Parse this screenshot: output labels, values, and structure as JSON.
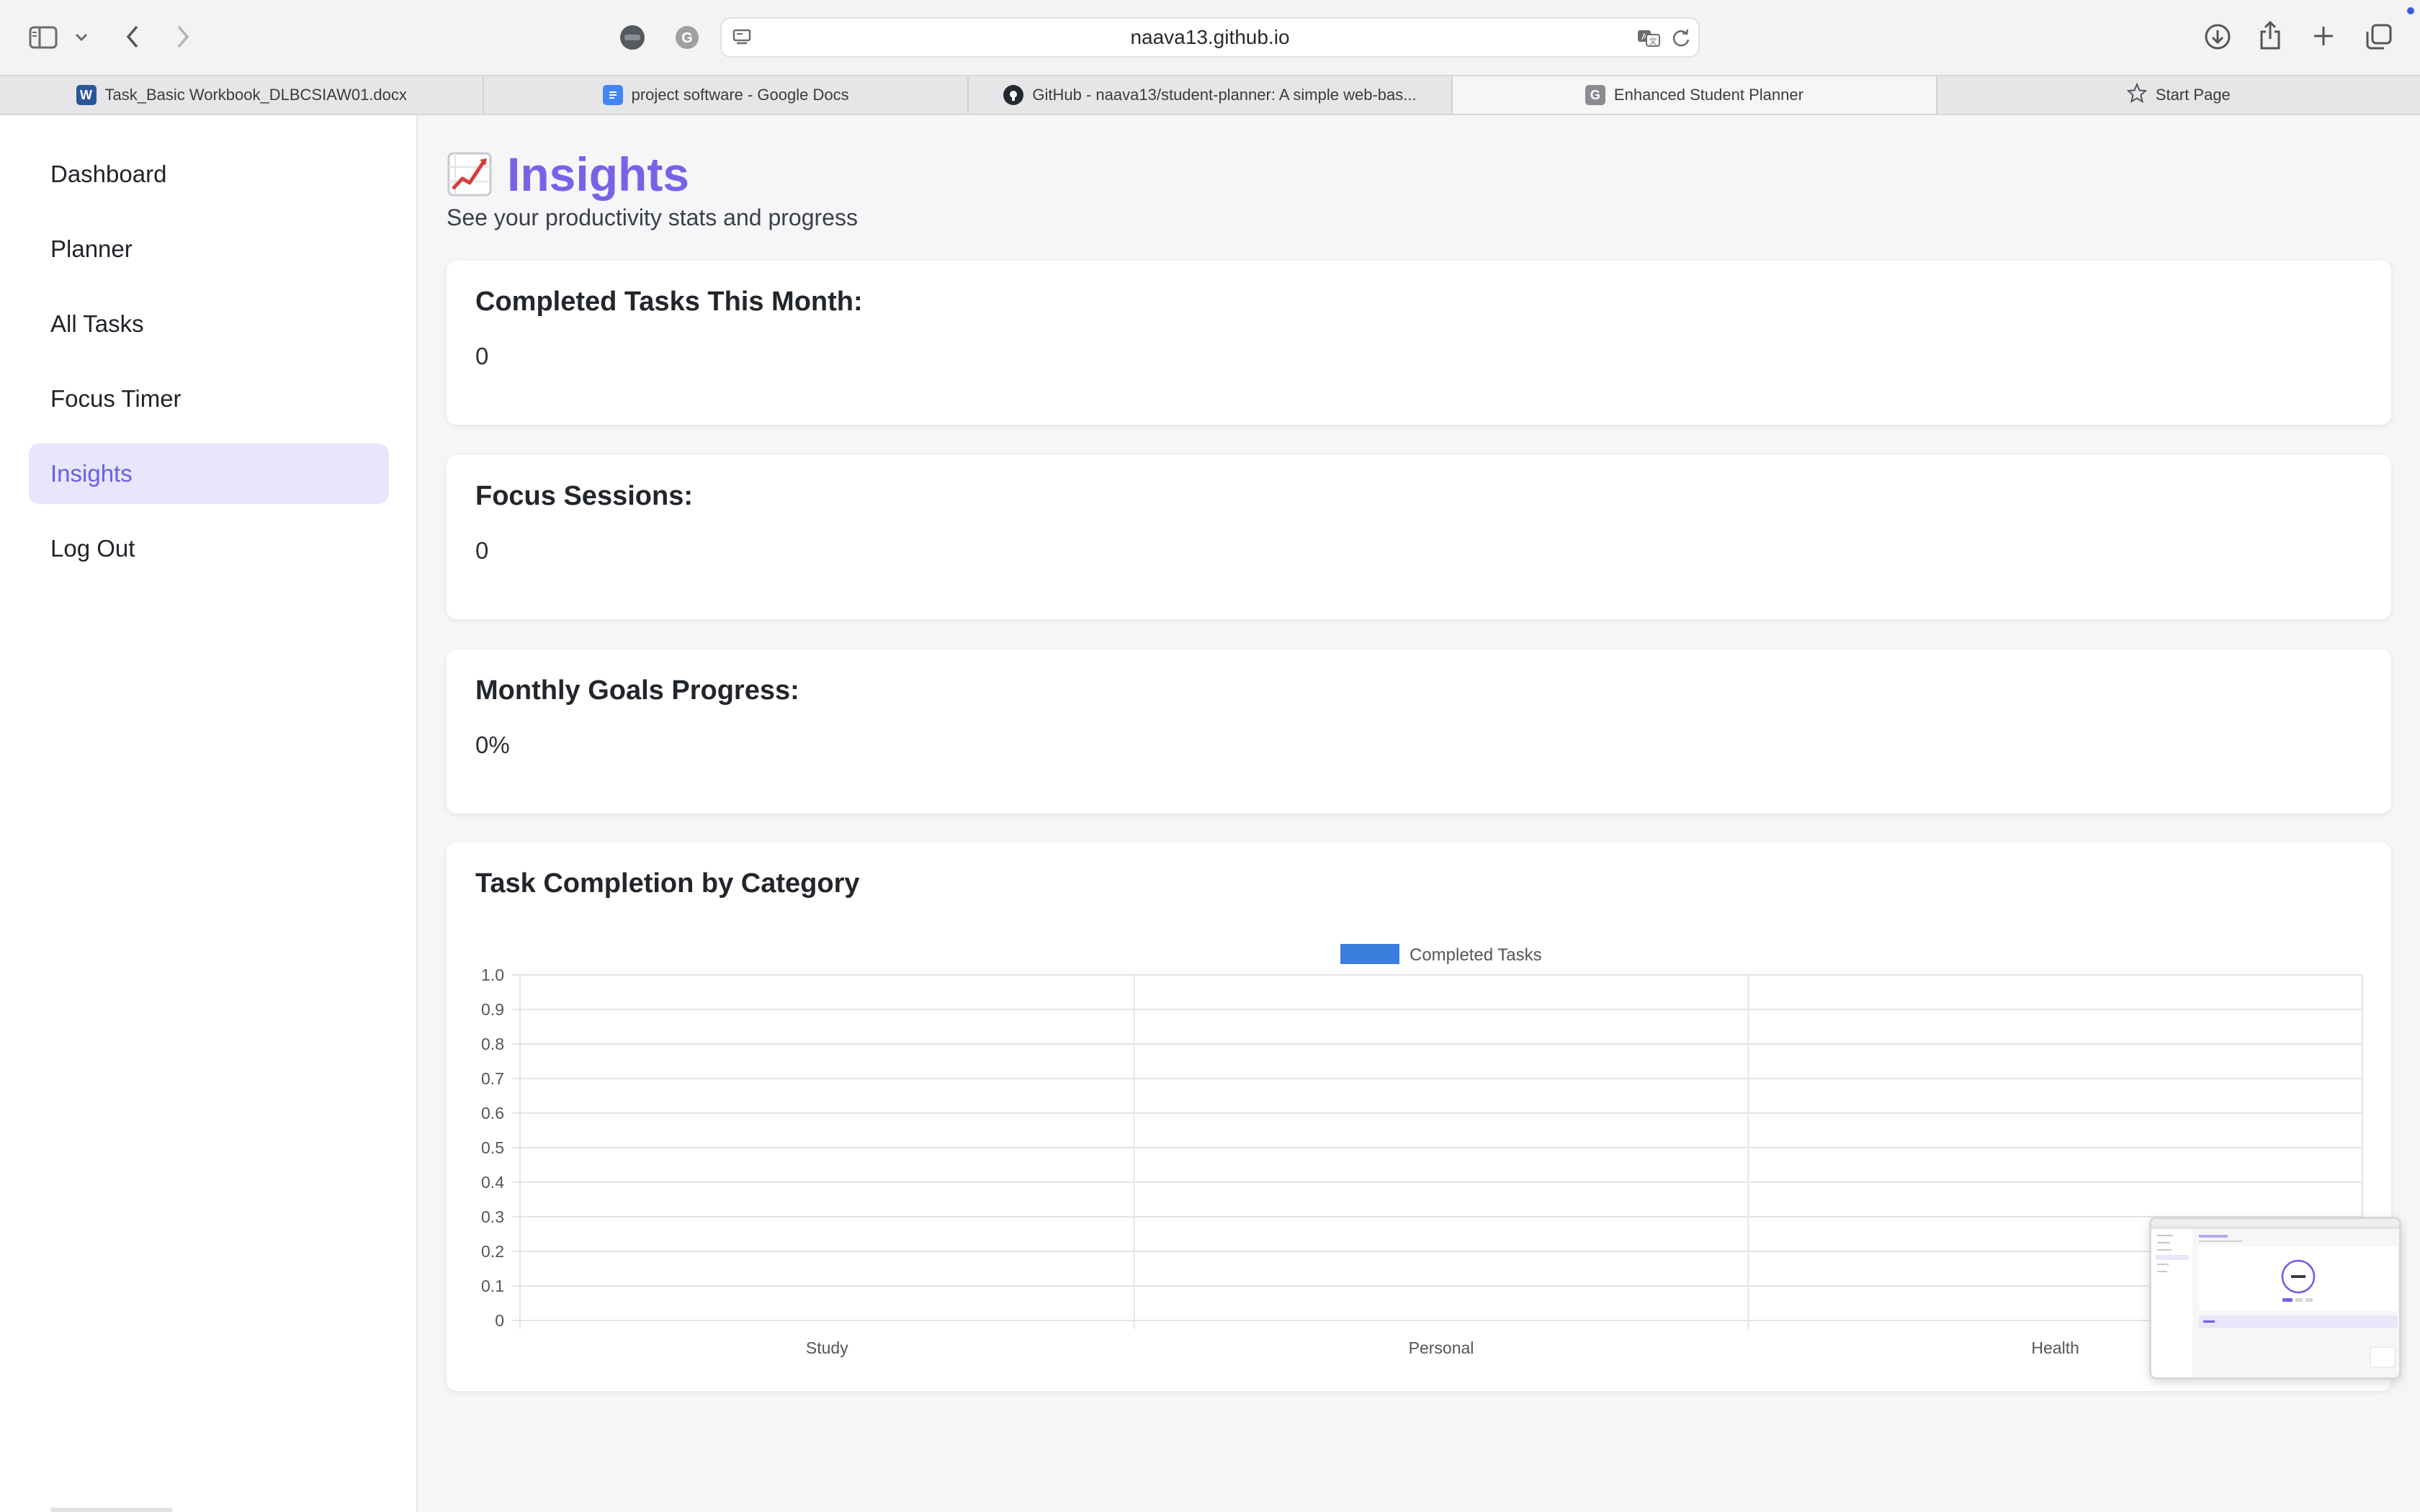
{
  "browser": {
    "url": "naava13.github.io",
    "tabs": [
      {
        "label": "Task_Basic Workbook_DLBCSIAW01.docx",
        "icon": "word-icon"
      },
      {
        "label": "project software - Google Docs",
        "icon": "google-docs-icon"
      },
      {
        "label": "GitHub - naava13/student-planner: A simple web-bas...",
        "icon": "github-icon"
      },
      {
        "label": "Enhanced Student Planner",
        "icon": "grammarly-g-icon"
      },
      {
        "label": "Start Page",
        "icon": "star-icon"
      }
    ],
    "active_tab": 3
  },
  "sidebar": {
    "items": [
      {
        "label": "Dashboard"
      },
      {
        "label": "Planner"
      },
      {
        "label": "All Tasks"
      },
      {
        "label": "Focus Timer"
      },
      {
        "label": "Insights"
      },
      {
        "label": "Log Out"
      }
    ],
    "active_index": 4
  },
  "page": {
    "title": "Insights",
    "title_icon": "chart-increasing-icon",
    "subtitle": "See your productivity stats and progress"
  },
  "stats": [
    {
      "label": "Completed Tasks This Month:",
      "value": "0"
    },
    {
      "label": "Focus Sessions:",
      "value": "0"
    },
    {
      "label": "Monthly Goals Progress:",
      "value": "0%"
    }
  ],
  "chart_card": {
    "title": "Task Completion by Category"
  },
  "chart_data": {
    "type": "bar",
    "categories": [
      "Study",
      "Personal",
      "Health"
    ],
    "series": [
      {
        "name": "Completed Tasks",
        "values": [
          0,
          0,
          0
        ],
        "color": "#3b7ddd"
      }
    ],
    "ylim": [
      0,
      1.0
    ],
    "yticks": [
      "0",
      "0.1",
      "0.2",
      "0.3",
      "0.4",
      "0.5",
      "0.6",
      "0.7",
      "0.8",
      "0.9",
      "1.0"
    ],
    "grid": true,
    "legend_position": "top-center"
  },
  "colors": {
    "accent": "#7b61e8",
    "active_nav_bg": "#e8e6fb",
    "bar": "#3b7ddd"
  }
}
